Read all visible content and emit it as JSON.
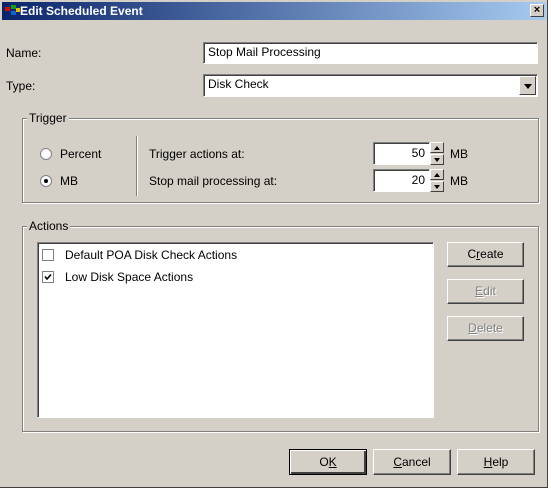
{
  "window": {
    "title": "Edit Scheduled Event",
    "close_label": "×"
  },
  "form": {
    "name_label": "Name:",
    "name_value": "Stop Mail Processing",
    "type_label": "Type:",
    "type_value": "Disk Check"
  },
  "trigger": {
    "title": "Trigger",
    "options": [
      {
        "label": "Percent",
        "selected": false
      },
      {
        "label": "MB",
        "selected": true
      }
    ],
    "rows": [
      {
        "label": "Trigger actions at:",
        "value": "50",
        "unit": "MB"
      },
      {
        "label": "Stop mail processing at:",
        "value": "20",
        "unit": "MB"
      }
    ]
  },
  "actions": {
    "title": "Actions",
    "items": [
      {
        "label": "Default POA Disk Check Actions",
        "checked": false
      },
      {
        "label": "Low Disk Space Actions",
        "checked": true
      }
    ],
    "create": {
      "pre": "C",
      "mn": "r",
      "post": "eate",
      "enabled": true
    },
    "edit": {
      "pre": "",
      "mn": "E",
      "post": "dit",
      "enabled": false
    },
    "delete": {
      "pre": "",
      "mn": "D",
      "post": "elete",
      "enabled": false
    }
  },
  "footer": {
    "ok": {
      "pre": "O",
      "mn": "K",
      "post": ""
    },
    "cancel": {
      "pre": "",
      "mn": "C",
      "post": "ancel"
    },
    "help": {
      "pre": "",
      "mn": "H",
      "post": "elp"
    }
  }
}
